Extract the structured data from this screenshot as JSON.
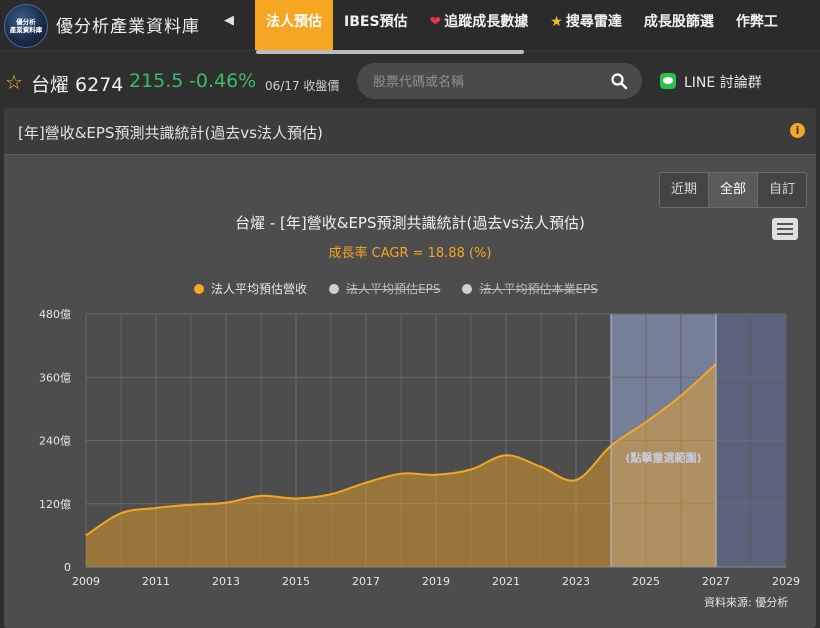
{
  "nav": {
    "logo_text": [
      "優分析",
      "產業資料庫"
    ],
    "site_title": "優分析產業資料庫",
    "tabs": [
      {
        "label": "法人預估",
        "active": true,
        "icon": ""
      },
      {
        "label": "IBES預估",
        "active": false,
        "icon": ""
      },
      {
        "label": "追蹤成長數據",
        "active": false,
        "icon": "heart-icon"
      },
      {
        "label": "搜尋雷達",
        "active": false,
        "icon": "star-icon"
      },
      {
        "label": "成長股篩選",
        "active": false,
        "icon": ""
      },
      {
        "label": "作弊工",
        "active": false,
        "icon": ""
      }
    ]
  },
  "stock": {
    "name": "台燿 6274",
    "price": "215.5",
    "change": "-0.46%",
    "date": "06/17 收盤價"
  },
  "search": {
    "placeholder": "股票代碼或名稱"
  },
  "line_link": "LINE 討論群",
  "panel": {
    "title": "[年]營收&EPS預測共識統計(過去vs法人預估)",
    "range_buttons": [
      {
        "label": "近期",
        "active": false
      },
      {
        "label": "全部",
        "active": true
      },
      {
        "label": "自訂",
        "active": false
      }
    ],
    "source": "資料來源: 優分析"
  },
  "chart_data": {
    "type": "area",
    "title": "台燿 - [年]營收&EPS預測共識統計(過去vs法人預估)",
    "subtitle": "成長率 CAGR = 18.88 (%)",
    "legend": [
      {
        "name": "法人平均預估營收",
        "color": "#f5a623",
        "visible": true
      },
      {
        "name": "法人平均預估EPS",
        "color": "#d0d0d0",
        "visible": false
      },
      {
        "name": "法人平均預估本業EPS",
        "color": "#d0d0d0",
        "visible": false
      }
    ],
    "legend_position": "top-center",
    "x_ticks": [
      2009,
      2011,
      2013,
      2015,
      2017,
      2019,
      2021,
      2023,
      2025,
      2027,
      2029
    ],
    "y_ticks": [
      "0",
      "120億",
      "240億",
      "360億",
      "480億"
    ],
    "xlim": [
      2009,
      2029
    ],
    "ylim": [
      0,
      480
    ],
    "grid": true,
    "series": [
      {
        "name": "法人平均預估營收",
        "x": [
          2009,
          2010,
          2011,
          2012,
          2013,
          2014,
          2015,
          2016,
          2017,
          2018,
          2019,
          2020,
          2021,
          2022,
          2023,
          2024,
          2025,
          2026,
          2027
        ],
        "values": [
          60,
          102,
          112,
          118,
          122,
          135,
          130,
          138,
          160,
          177,
          175,
          185,
          212,
          190,
          165,
          230,
          275,
          325,
          385
        ]
      }
    ],
    "highlight_band": {
      "x_from": 2024,
      "x_to": 2027,
      "label": "(點擊重選範圍)"
    },
    "dim_band": {
      "x_from": 2027,
      "x_to": 2029
    }
  }
}
